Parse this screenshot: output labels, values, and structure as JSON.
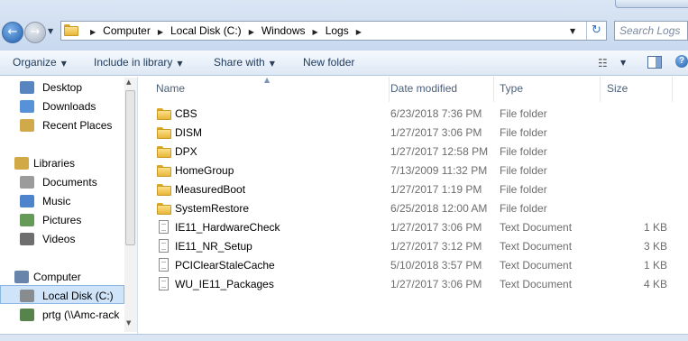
{
  "window": {
    "search_placeholder": "Search Logs",
    "refresh_icon": "refresh-icon"
  },
  "breadcrumb": {
    "root_icon": "folder-icon",
    "items": [
      "Computer",
      "Local Disk (C:)",
      "Windows",
      "Logs"
    ]
  },
  "toolbar": {
    "organize": "Organize",
    "include_in_library": "Include in library",
    "share_with": "Share with",
    "new_folder": "New folder"
  },
  "navigation": {
    "items": [
      {
        "label": "Desktop",
        "icon": "desktop-icon"
      },
      {
        "label": "Downloads",
        "icon": "downloads-icon"
      },
      {
        "label": "Recent Places",
        "icon": "recent-places-icon"
      },
      {
        "label": "Libraries",
        "icon": "libraries-icon"
      },
      {
        "label": "Documents",
        "icon": "documents-icon"
      },
      {
        "label": "Music",
        "icon": "music-icon"
      },
      {
        "label": "Pictures",
        "icon": "pictures-icon"
      },
      {
        "label": "Videos",
        "icon": "videos-icon"
      },
      {
        "label": "Computer",
        "icon": "computer-icon"
      },
      {
        "label": "Local Disk (C:)",
        "icon": "drive-icon",
        "selected": true
      },
      {
        "label": "prtg (\\\\Amc-rack",
        "icon": "network-drive-icon"
      }
    ]
  },
  "columns": {
    "name": "Name",
    "date_modified": "Date modified",
    "type": "Type",
    "size": "Size"
  },
  "files": [
    {
      "name": "CBS",
      "date": "6/23/2018 7:36 PM",
      "type": "File folder",
      "size": "",
      "kind": "folder"
    },
    {
      "name": "DISM",
      "date": "1/27/2017 3:06 PM",
      "type": "File folder",
      "size": "",
      "kind": "folder"
    },
    {
      "name": "DPX",
      "date": "1/27/2017 12:58 PM",
      "type": "File folder",
      "size": "",
      "kind": "folder"
    },
    {
      "name": "HomeGroup",
      "date": "7/13/2009 11:32 PM",
      "type": "File folder",
      "size": "",
      "kind": "folder"
    },
    {
      "name": "MeasuredBoot",
      "date": "1/27/2017 1:19 PM",
      "type": "File folder",
      "size": "",
      "kind": "folder"
    },
    {
      "name": "SystemRestore",
      "date": "6/25/2018 12:00 AM",
      "type": "File folder",
      "size": "",
      "kind": "folder"
    },
    {
      "name": "IE11_HardwareCheck",
      "date": "1/27/2017 3:06 PM",
      "type": "Text Document",
      "size": "1 KB",
      "kind": "text"
    },
    {
      "name": "IE11_NR_Setup",
      "date": "1/27/2017 3:12 PM",
      "type": "Text Document",
      "size": "3 KB",
      "kind": "text"
    },
    {
      "name": "PCIClearStaleCache",
      "date": "5/10/2018 3:57 PM",
      "type": "Text Document",
      "size": "1 KB",
      "kind": "text"
    },
    {
      "name": "WU_IE11_Packages",
      "date": "1/27/2017 3:06 PM",
      "type": "Text Document",
      "size": "4 KB",
      "kind": "text"
    }
  ]
}
